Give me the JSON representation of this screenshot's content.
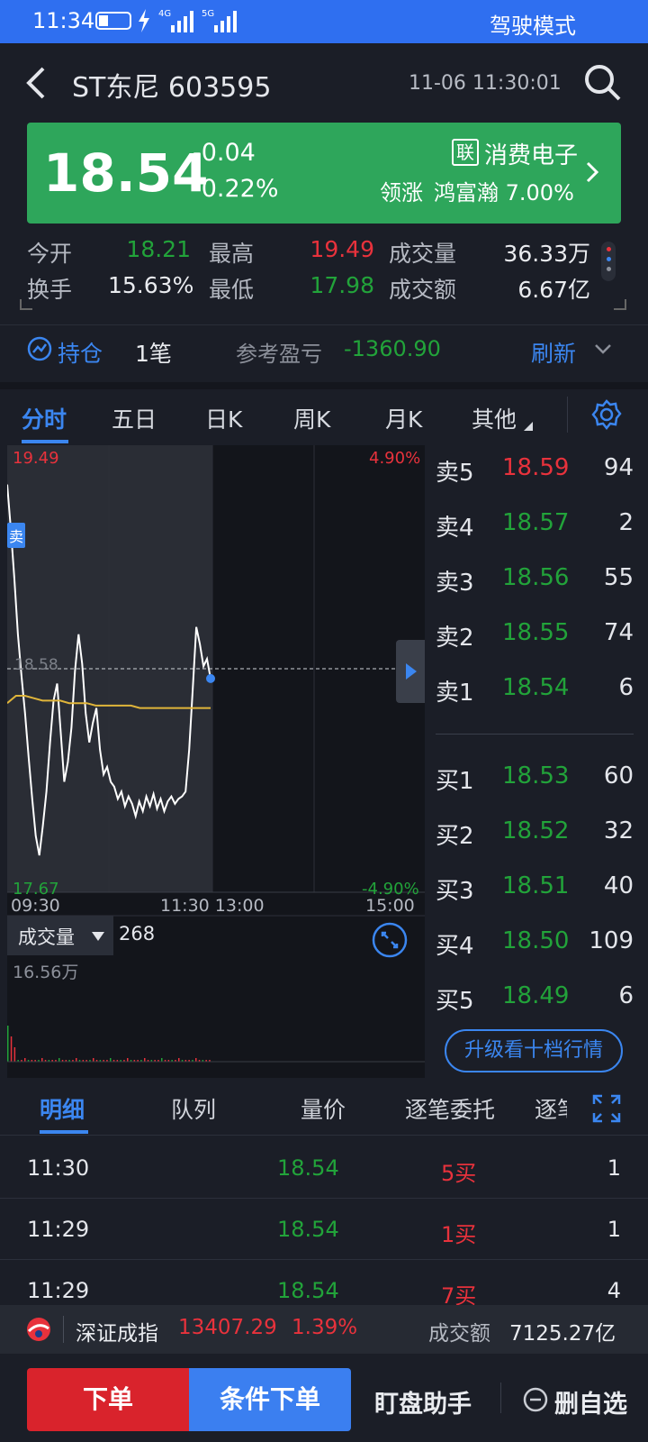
{
  "status_bar": {
    "time": "11:34",
    "net1": "4G",
    "net2": "5G",
    "mode": "驾驶模式"
  },
  "header": {
    "title": "ST东尼 603595",
    "datetime": "11-06 11:30:01"
  },
  "quote": {
    "price": "18.54",
    "change": "-0.04",
    "change_pct": "-0.22%",
    "sector_badge": "联",
    "sector": "消费电子",
    "leader_label": "领涨",
    "leader": "鸿富瀚 7.00%"
  },
  "stats": [
    {
      "label": "今开",
      "value": "18.21",
      "color": "green"
    },
    {
      "label": "最高",
      "value": "19.49",
      "color": "red"
    },
    {
      "label": "成交量",
      "value": "36.33万",
      "color": "white"
    },
    {
      "label": "换手",
      "value": "15.63%",
      "color": "white"
    },
    {
      "label": "最低",
      "value": "17.98",
      "color": "green"
    },
    {
      "label": "成交额",
      "value": "6.67亿",
      "color": "white"
    }
  ],
  "position": {
    "label": "持仓",
    "count": "1笔",
    "pl_label": "参考盈亏",
    "pl_value": "-1360.90",
    "refresh": "刷新"
  },
  "chart_tabs": [
    "分时",
    "五日",
    "日K",
    "周K",
    "月K",
    "其他"
  ],
  "chart_data": {
    "type": "line",
    "y_top_label": "19.49",
    "y_bottom_label": "17.67",
    "y_mid_label": "18.58",
    "pct_top": "4.90%",
    "pct_bottom": "-4.90%",
    "x_labels": [
      "09:30",
      "11:30 13:00",
      "15:00"
    ],
    "ylim": [
      17.67,
      19.49
    ],
    "sell_marker": "卖",
    "series": [
      {
        "values": [
          19.33,
          19.15,
          18.95,
          18.72,
          18.55,
          18.4,
          18.22,
          18.05,
          17.9,
          17.82,
          17.94,
          18.08,
          18.28,
          18.45,
          18.52,
          18.32,
          18.12,
          18.2,
          18.34,
          18.57,
          18.72,
          18.6,
          18.4,
          18.28,
          18.36,
          18.42,
          18.25,
          18.15,
          18.18,
          18.12,
          18.1,
          18.05,
          18.08,
          18.02,
          18.06,
          18.03,
          17.98,
          18.04,
          18.0,
          18.06,
          18.02,
          18.07,
          18.01,
          18.05,
          18.0,
          18.04,
          18.06,
          18.03,
          18.05,
          18.06,
          18.08,
          18.25,
          18.5,
          18.75,
          18.68,
          18.59,
          18.62,
          18.54
        ]
      },
      {
        "values": [
          18.44,
          18.47,
          18.47,
          18.46,
          18.45,
          18.45,
          18.45,
          18.44,
          18.44,
          18.44,
          18.43,
          18.43,
          18.43,
          18.43,
          18.43,
          18.42,
          18.42,
          18.42,
          18.42,
          18.42,
          18.42,
          18.42,
          18.42,
          18.42
        ]
      }
    ],
    "volume_label": "成交量",
    "volume_value": "268",
    "volume_max": "16.56万"
  },
  "orderbook": {
    "asks": [
      {
        "label": "卖5",
        "price": "18.59",
        "vol": "94",
        "color": "red"
      },
      {
        "label": "卖4",
        "price": "18.57",
        "vol": "2",
        "color": "green"
      },
      {
        "label": "卖3",
        "price": "18.56",
        "vol": "55",
        "color": "green"
      },
      {
        "label": "卖2",
        "price": "18.55",
        "vol": "74",
        "color": "green"
      },
      {
        "label": "卖1",
        "price": "18.54",
        "vol": "6",
        "color": "green"
      }
    ],
    "bids": [
      {
        "label": "买1",
        "price": "18.53",
        "vol": "60",
        "color": "green"
      },
      {
        "label": "买2",
        "price": "18.52",
        "vol": "32",
        "color": "green"
      },
      {
        "label": "买3",
        "price": "18.51",
        "vol": "40",
        "color": "green"
      },
      {
        "label": "买4",
        "price": "18.50",
        "vol": "109",
        "color": "green"
      },
      {
        "label": "买5",
        "price": "18.49",
        "vol": "6",
        "color": "green"
      }
    ],
    "upgrade": "升级看十档行情"
  },
  "detail_tabs": [
    "明细",
    "队列",
    "量价",
    "逐笔委托",
    "逐笔"
  ],
  "trades": [
    {
      "time": "11:30",
      "price": "18.54",
      "side": "5买",
      "vol": "1"
    },
    {
      "time": "11:29",
      "price": "18.54",
      "side": "1买",
      "vol": "1"
    },
    {
      "time": "11:29",
      "price": "18.54",
      "side": "7买",
      "vol": "4"
    }
  ],
  "index": {
    "name": "深证成指",
    "value": "13407.29",
    "pct": "1.39%",
    "amount_label": "成交额",
    "amount": "7125.27亿"
  },
  "actions": {
    "order": "下单",
    "cond_order": "条件下单",
    "assistant": "盯盘助手",
    "remove": "删自选"
  },
  "colors": {
    "red": "#e8323c",
    "green": "#22a33a",
    "accent": "#3b86f0",
    "banner": "#2ea65b",
    "avg_line": "#e0b53a"
  }
}
